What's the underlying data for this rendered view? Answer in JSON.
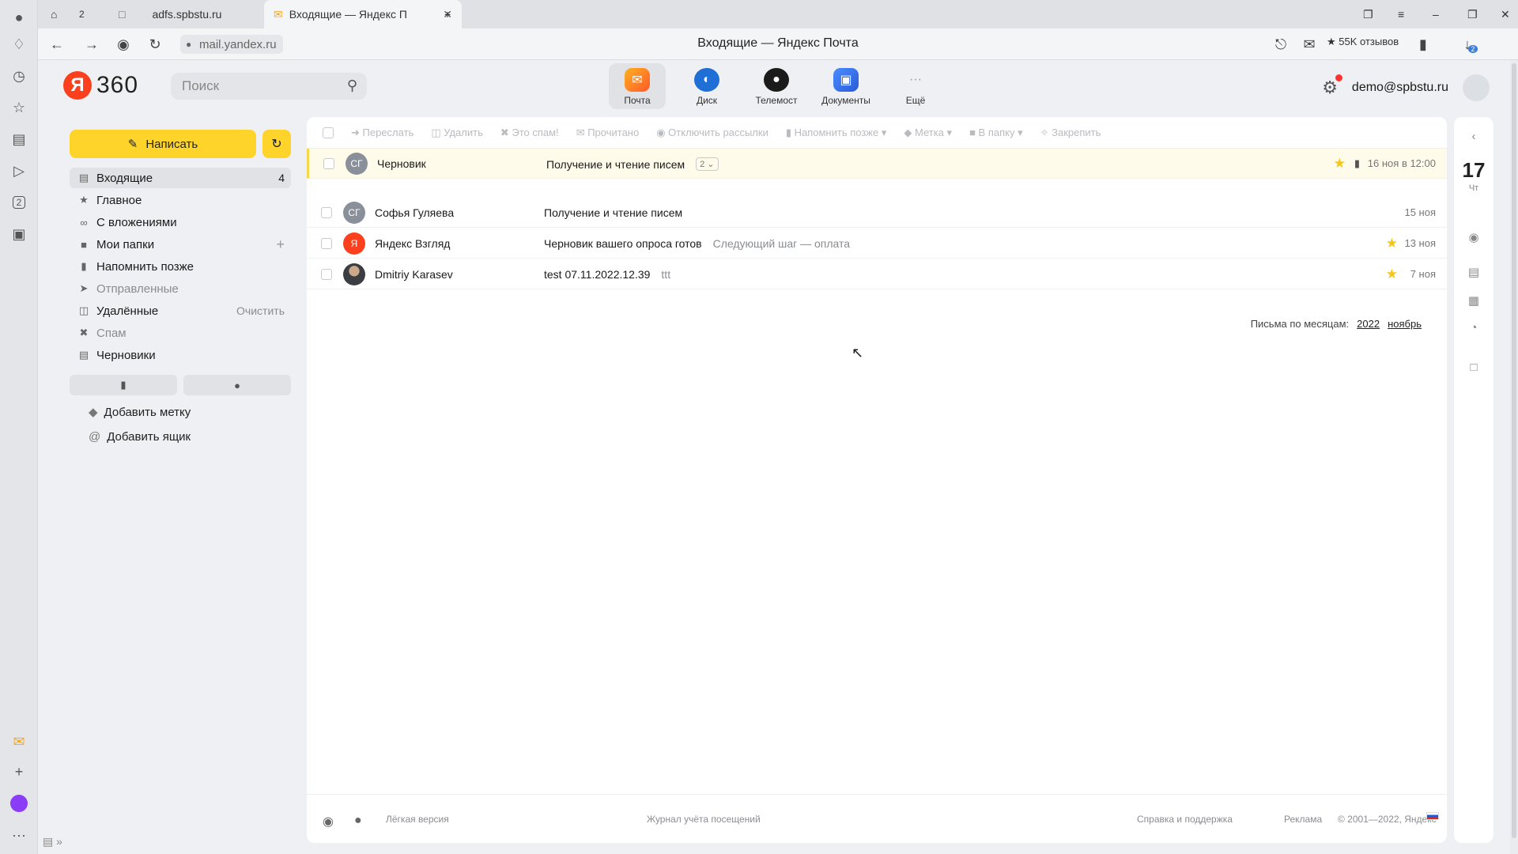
{
  "browser": {
    "tabs": [
      {
        "label": "adfs.spbstu.ru"
      },
      {
        "label": "Входящие — Яндекс П"
      }
    ],
    "tab_count_badge": "2",
    "url": "mail.yandex.ru",
    "title": "Входящие — Яндекс Почта",
    "reviews": "★ 55K отзывов",
    "rail_badge": "2",
    "download_badge": "2"
  },
  "header": {
    "logo_letter": "Я",
    "logo_text": "360",
    "search_placeholder": "Поиск",
    "services": [
      {
        "label": "Почта"
      },
      {
        "label": "Диск"
      },
      {
        "label": "Телемост"
      },
      {
        "label": "Документы"
      },
      {
        "label": "Ещё"
      }
    ],
    "user": "demo@spbstu.ru"
  },
  "sidebar": {
    "compose_label": "Написать",
    "folders": [
      {
        "label": "Входящие",
        "count": "4"
      },
      {
        "label": "Главное"
      },
      {
        "label": "С вложениями"
      },
      {
        "label": "Мои папки"
      },
      {
        "label": "Напомнить позже"
      },
      {
        "label": "Отправленные"
      },
      {
        "label": "Удалённые",
        "action": "Очистить"
      },
      {
        "label": "Спам"
      },
      {
        "label": "Черновики"
      }
    ],
    "add_label": "Добавить метку",
    "add_box": "Добавить ящик"
  },
  "toolbar": {
    "actions": [
      "Переслать",
      "Удалить",
      "Это спам!",
      "Прочитано",
      "Отключить рассылки",
      "Напомнить позже",
      "Метка",
      "В папку",
      "Закрепить"
    ]
  },
  "messages": [
    {
      "initials": "СГ",
      "from": "Черновик",
      "subject": "Получение и чтение писем",
      "thread": "2",
      "date": "16 ноя",
      "time": "в 12:00",
      "starred": true,
      "pinned": true
    },
    {
      "initials": "СГ",
      "from": "Софья Гуляева",
      "subject": "Получение и чтение писем",
      "date": "15 ноя"
    },
    {
      "initials": "Я",
      "from": "Яндекс Взгляд",
      "subject": "Черновик вашего опроса готов",
      "snippet": "Следующий шаг — оплата",
      "date": "13 ноя",
      "starred": true
    },
    {
      "initials": "",
      "from": "Dmitriy Karasev",
      "subject": "test 07.11.2022.12.39",
      "snippet": "ttt",
      "date": "7 ноя",
      "starred": true
    }
  ],
  "months": {
    "label": "Письма по месяцам:",
    "year": "2022",
    "month": "ноябрь"
  },
  "footer": {
    "light": "Лёгкая версия",
    "journal": "Журнал учёта посещений",
    "help": "Справка и поддержка",
    "ads": "Реклама",
    "copyright": "© 2001—2022, Яндекс"
  },
  "calendar": {
    "day": "17",
    "weekday": "Чт"
  },
  "colors": {
    "accent": "#fed42b",
    "brand": "#fc3f1d",
    "star": "#f5c518"
  }
}
